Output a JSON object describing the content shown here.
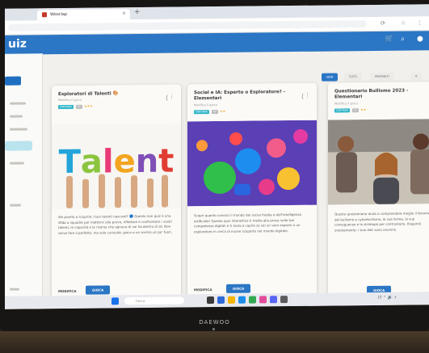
{
  "browser": {
    "tab_title": "Wooclap",
    "new_tab": "+",
    "tab_close": "×",
    "url": "",
    "icons": [
      "reload-icon",
      "star-icon",
      "menu-icon"
    ]
  },
  "app": {
    "brand": "uiz",
    "header_icons": [
      "cart-icon",
      "search-icon",
      "user-icon"
    ]
  },
  "filters": [
    {
      "label": "NEW",
      "active": true
    },
    {
      "label": "TUTTI",
      "active": false
    },
    {
      "label": "PREFERITI",
      "active": false
    },
    {
      "label": "A",
      "active": false
    }
  ],
  "cards": [
    {
      "title": "Esploratori di Talenti 🎨",
      "subtitle": "Modifica il gioco",
      "tags": [
        "CONTINUA",
        "SC",
        "★★★"
      ],
      "image": "talent-letters-photo",
      "image_text": "Talent",
      "description": "Sei pronto a scoprire i tuoi talenti nascosti? 🔵 Questo non quiz è una sfida a squadre per mettervi alla prova, riflettere e confrontare i vostri talenti, le capacità e le risorse che ognuno di voi ha dentro di sé. Non serve fare il perfetto, ma solo curiosità, gioco e un sorriso un po' fuori.",
      "secondary": "MODIFICA",
      "primary": "GIOCA"
    },
    {
      "title": "Social e IA: Esperto o Esploratore? - Elementari",
      "subtitle": "Modifica il gioco",
      "tags": [
        "CONTINUA",
        "SC",
        "★★"
      ],
      "image": "social-media-icons-illustration",
      "description": "Scopri quanto conosci il mondo dei social media e dell'intelligenza artificiale! Questo quiz interattivo ti mette alla prova sulle tue competenze digitali e ti aiuta a capire se sei un vero esperto o un esploratore in cerca di nuove scoperte nel mondo digitale.",
      "secondary": "MODIFICA",
      "primary": "GIOCA"
    },
    {
      "title": "Questionario Bullismo 2023 - Elementari",
      "subtitle": "Modifica il gioco",
      "tags": [
        "CONTINUA",
        "SC",
        "★★"
      ],
      "image": "sad-girl-classroom-photo",
      "description": "Questo questionario aiuta a comprendere meglio il fenomeno del bullismo e cyberbullismo, le sue forme, le sue conseguenze e le strategie per contrastarlo. Rispondi onestamente: i tuoi dati sono anonimi.",
      "secondary": "",
      "primary": "GIOCA"
    }
  ],
  "taskbar": {
    "search_placeholder": "Cerca",
    "tray": "IT  ⌃  🔊  ⚡"
  },
  "monitor": {
    "brand": "DAEWOO"
  },
  "colors": {
    "accent": "#2b76c5",
    "tag": "#33b6c9",
    "header": "#2b76c5"
  }
}
